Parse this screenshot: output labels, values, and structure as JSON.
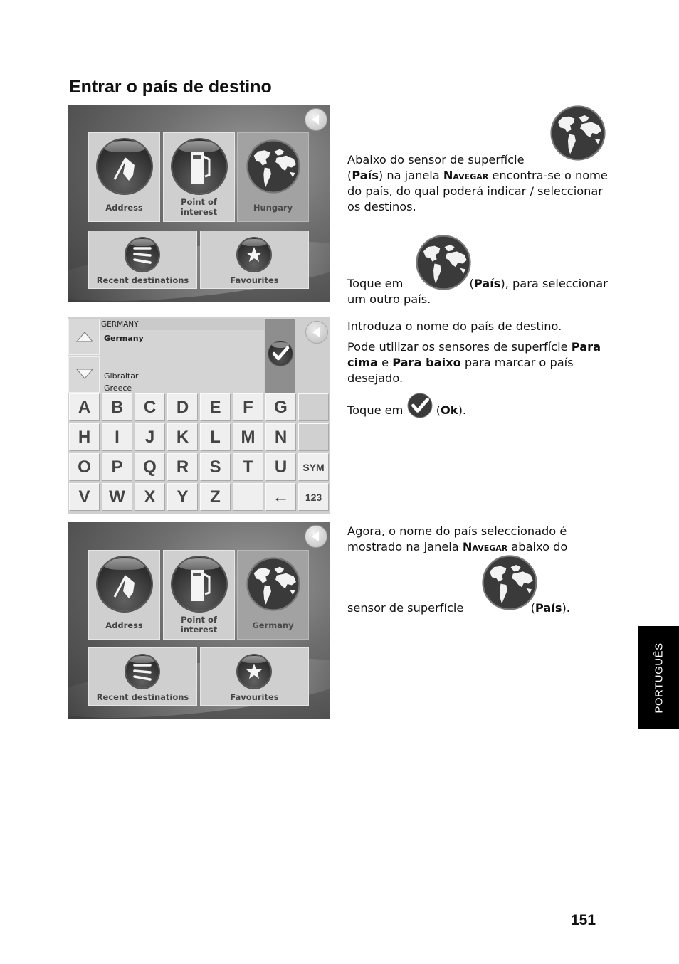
{
  "page": {
    "title": "Entrar o país de destino",
    "page_number": "151",
    "language_tab": "PORTUGUÊS"
  },
  "screen1": {
    "tiles": [
      {
        "label": "Address",
        "icon": "flag-icon"
      },
      {
        "label_line1": "Point of",
        "label_line2": "interest",
        "icon": "fuel-pump-icon"
      },
      {
        "label": "Hungary",
        "icon": "globe-icon",
        "selected": true
      },
      {
        "label": "Recent destinations",
        "icon": "list-icon"
      },
      {
        "label": "Favourites",
        "icon": "star-icon"
      }
    ],
    "back_icon": "back-arrow-icon"
  },
  "screen2": {
    "search_text": "GERMANY",
    "list": [
      "Germany",
      "Gibraltar",
      "Greece"
    ],
    "selected_item": "Germany",
    "keys": [
      [
        "A",
        "B",
        "C",
        "D",
        "E",
        "F",
        "G",
        ""
      ],
      [
        "H",
        "I",
        "J",
        "K",
        "L",
        "M",
        "N",
        ""
      ],
      [
        "O",
        "P",
        "Q",
        "R",
        "S",
        "T",
        "U",
        "SYM"
      ],
      [
        "V",
        "W",
        "X",
        "Y",
        "Z",
        "_",
        "←",
        "123"
      ]
    ],
    "up_icon": "arrow-up-icon",
    "down_icon": "arrow-down-icon",
    "ok_icon": "checkmark-icon",
    "back_icon": "back-arrow-icon"
  },
  "screen3": {
    "tiles": [
      {
        "label": "Address",
        "icon": "flag-icon"
      },
      {
        "label_line1": "Point of",
        "label_line2": "interest",
        "icon": "fuel-pump-icon"
      },
      {
        "label": "Germany",
        "icon": "globe-icon",
        "selected": true
      },
      {
        "label": "Recent destinations",
        "icon": "list-icon"
      },
      {
        "label": "Favourites",
        "icon": "star-icon"
      }
    ],
    "back_icon": "back-arrow-icon"
  },
  "text": {
    "p1_a": "Abaixo do sensor de superfície",
    "p1_b_open": "(",
    "p1_b_bold": "País",
    "p1_b_mid": ") na janela ",
    "p1_b_sc": "Navegar",
    "p1_b_rest": " encontra-se o nome do país, do qual poderá indicar / seleccionar os destinos.",
    "p2_a": "Toque em ",
    "p2_open": " (",
    "p2_bold": "País",
    "p2_rest": "), para seleccionar um outro país.",
    "p3": "Introduza o nome do país de destino.",
    "p4_a": "Pode utilizar os sensores de superfície ",
    "p4_bold1": "Para cima",
    "p4_mid": " e ",
    "p4_bold2": "Para baixo",
    "p4_rest": " para marcar o país desejado.",
    "p5_a": "Toque em ",
    "p5_open": " (",
    "p5_bold": "Ok",
    "p5_rest": ").",
    "p6_a": "Agora, o nome do país seleccionado é mostrado na janela ",
    "p6_sc": "Navegar",
    "p6_b": " abaixo do",
    "p6_c": "sensor de superfície ",
    "p6_open": " (",
    "p6_bold": "País",
    "p6_rest": ")."
  }
}
